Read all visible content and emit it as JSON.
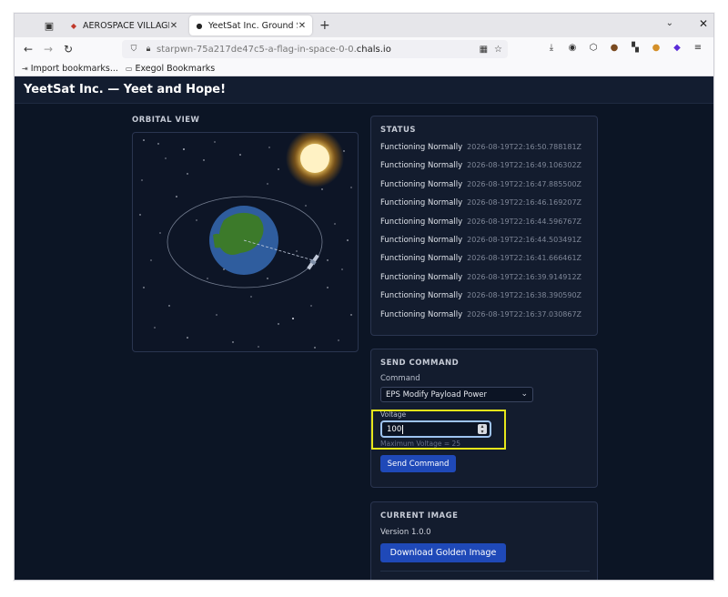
{
  "browser": {
    "tabs": [
      {
        "title": "AEROSPACE VILLAGE S",
        "active": false
      },
      {
        "title": "YeetSat Inc. Ground St",
        "active": true
      }
    ],
    "url_prefix": "starpwn-75a217de47c5-a-flag-in-space-0-0.",
    "url_domain": "chals.io",
    "bookmarks": [
      {
        "label": "Import bookmarks...",
        "icon": "import-icon"
      },
      {
        "label": "Exegol Bookmarks",
        "icon": "folder-icon"
      }
    ]
  },
  "page": {
    "title": "YeetSat Inc. — Yeet and Hope!",
    "orbital_label": "ORBITAL VIEW",
    "status": {
      "heading": "STATUS",
      "entries": [
        {
          "text": "Functioning Normally",
          "time": "2026-08-19T22:16:50.788181Z"
        },
        {
          "text": "Functioning Normally",
          "time": "2026-08-19T22:16:49.106302Z"
        },
        {
          "text": "Functioning Normally",
          "time": "2026-08-19T22:16:47.885500Z"
        },
        {
          "text": "Functioning Normally",
          "time": "2026-08-19T22:16:46.169207Z"
        },
        {
          "text": "Functioning Normally",
          "time": "2026-08-19T22:16:44.596767Z"
        },
        {
          "text": "Functioning Normally",
          "time": "2026-08-19T22:16:44.503491Z"
        },
        {
          "text": "Functioning Normally",
          "time": "2026-08-19T22:16:41.666461Z"
        },
        {
          "text": "Functioning Normally",
          "time": "2026-08-19T22:16:39.914912Z"
        },
        {
          "text": "Functioning Normally",
          "time": "2026-08-19T22:16:38.390590Z"
        },
        {
          "text": "Functioning Normally",
          "time": "2026-08-19T22:16:37.030867Z"
        }
      ]
    },
    "command": {
      "heading": "SEND COMMAND",
      "command_label": "Command",
      "selected_command": "EPS Modify Payload Power",
      "voltage_label": "Voltage",
      "voltage_value": "100",
      "voltage_hint": "Maximum Voltage = 25",
      "send_label": "Send Command"
    },
    "image": {
      "heading": "CURRENT IMAGE",
      "version": "Version 1.0.0",
      "download_label": "Download Golden Image"
    }
  },
  "colors": {
    "page_bg": "#0c1525",
    "panel_bg": "#131c2e",
    "accent_button": "#1f49b8",
    "highlight": "#e6e61a"
  }
}
